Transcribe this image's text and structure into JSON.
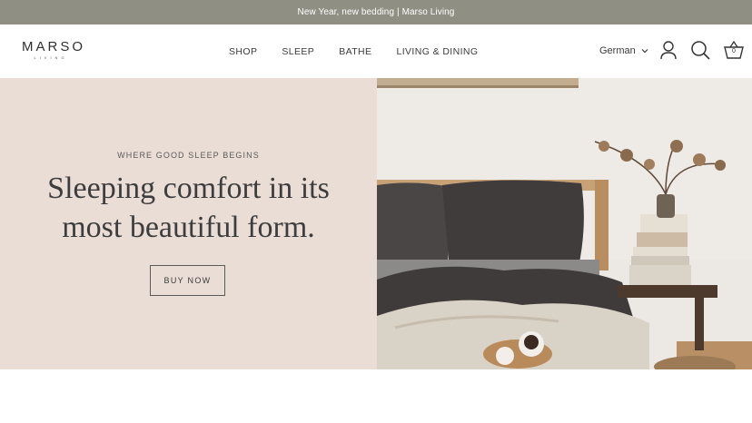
{
  "announcement": {
    "text": "New Year, new bedding | Marso Living"
  },
  "brand": {
    "name": "MARSO",
    "sub": "LIVING"
  },
  "nav": {
    "items": [
      {
        "label": "SHOP"
      },
      {
        "label": "SLEEP"
      },
      {
        "label": "BATHE"
      },
      {
        "label": "LIVING & DINING"
      }
    ]
  },
  "language": {
    "selected": "German"
  },
  "cart": {
    "count": "0"
  },
  "hero": {
    "eyebrow": "WHERE GOOD SLEEP BEGINS",
    "headline_line1": "Sleeping comfort in its",
    "headline_line2": "most beautiful form.",
    "cta_label": "BUY NOW"
  },
  "icons": [
    "user-icon",
    "search-icon",
    "basket-icon",
    "chevron-down-icon"
  ],
  "colors": {
    "announcement_bg": "#8f8f84",
    "hero_left_bg": "#eaddd6"
  }
}
